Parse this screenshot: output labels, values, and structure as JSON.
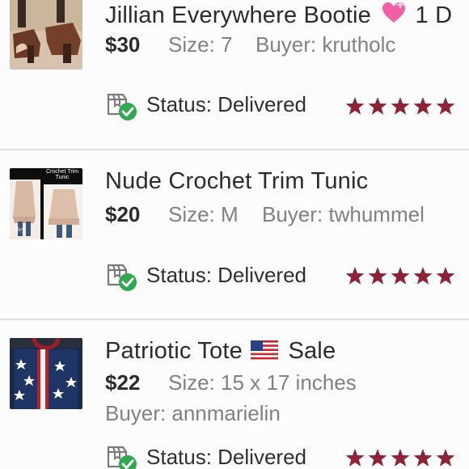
{
  "colors": {
    "star": "#8c2337",
    "check": "#2fa84f",
    "divider": "#e1dfe2"
  },
  "listings": [
    {
      "title": "Jillian Everywhere Bootie",
      "title_emoji": "heart-emoji",
      "title_suffix": "1 D",
      "price": "$30",
      "size": "Size: 7",
      "buyer": "Buyer: krutholc",
      "status": "Status: Delivered",
      "rating": 5,
      "thumb_icon": "bootie-photo"
    },
    {
      "title": "Nude Crochet Trim Tunic",
      "price": "$20",
      "size": "Size: M",
      "buyer": "Buyer: twhummel",
      "status": "Status: Delivered",
      "rating": 5,
      "thumb_icon": "tunic-photo",
      "thumb_caption": "Crochet Trim Tunic"
    },
    {
      "title": "Patriotic Tote",
      "title_emoji": "us-flag-emoji",
      "title_suffix": "Sale",
      "price": "$22",
      "size": "Size: 15 x 17 inches",
      "buyer": "Buyer: annmarielin",
      "status": "Status: Delivered",
      "rating": 5,
      "thumb_icon": "tote-photo"
    }
  ]
}
